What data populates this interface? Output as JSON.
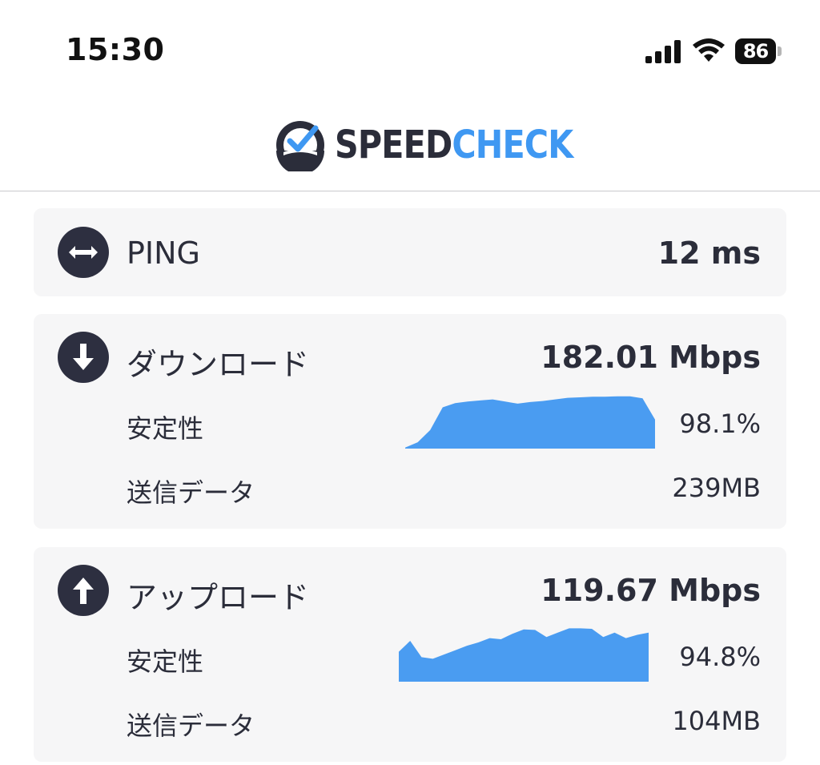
{
  "status_bar": {
    "time": "15:30",
    "battery_level": "86",
    "signal_icon": "cellular-signal-icon",
    "wifi_icon": "wifi-icon"
  },
  "header": {
    "logo_icon": "speedometer-check-icon",
    "logo_part1": "SPEED",
    "logo_part2": "CHECK",
    "logo_color_dark": "#2b2d3a",
    "logo_color_accent": "#3f98f2"
  },
  "ping": {
    "label": "PING",
    "value": "12 ms",
    "icon": "left-right-arrow-icon"
  },
  "download": {
    "label": "ダウンロード",
    "value": "182.01 Mbps",
    "icon": "down-arrow-icon",
    "stability_label": "安定性",
    "stability_value": "98.1%",
    "data_label": "送信データ",
    "data_value": "239MB",
    "stability_graph": [
      0.02,
      0.12,
      0.35,
      0.78,
      0.86,
      0.89,
      0.91,
      0.93,
      0.89,
      0.85,
      0.88,
      0.9,
      0.93,
      0.96,
      0.97,
      0.98,
      0.98,
      0.99,
      0.99,
      0.95,
      0.55
    ]
  },
  "upload": {
    "label": "アップロード",
    "value": "119.67 Mbps",
    "icon": "up-arrow-icon",
    "stability_label": "安定性",
    "stability_value": "94.8%",
    "data_label": "送信データ",
    "data_value": "104MB",
    "stability_graph": [
      0.55,
      0.75,
      0.45,
      0.42,
      0.5,
      0.58,
      0.66,
      0.72,
      0.8,
      0.78,
      0.88,
      0.96,
      0.95,
      0.82,
      0.9,
      0.98,
      0.98,
      0.97,
      0.82,
      0.9,
      0.8,
      0.86,
      0.9
    ]
  },
  "colors": {
    "graph_fill": "#4a9cf1",
    "icon_bg": "#2d2f40",
    "card_bg": "#f6f6f7"
  }
}
